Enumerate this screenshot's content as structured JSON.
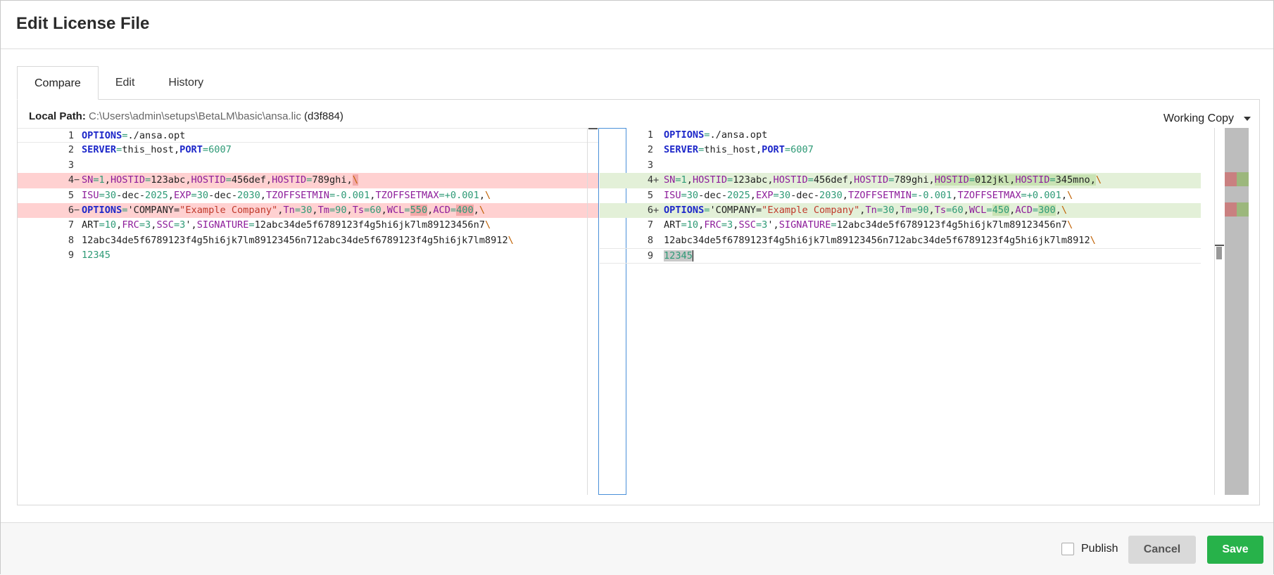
{
  "dialog": {
    "title": "Edit License File",
    "tabs": [
      {
        "label": "Compare",
        "active": true
      },
      {
        "label": "Edit",
        "active": false
      },
      {
        "label": "History",
        "active": false
      }
    ]
  },
  "compare": {
    "local_path_label": "Local Path:",
    "local_path": "C:\\Users\\admin\\setups\\BetaLM\\basic\\ansa.lic",
    "hash": "(d3f884)",
    "version_selector": "Working Copy",
    "line_numbers": [
      "1",
      "2",
      "3",
      "4",
      "5",
      "6",
      "7",
      "8",
      "9"
    ],
    "left_markers": [
      "",
      "",
      "",
      "−",
      "",
      "−",
      "",
      "",
      ""
    ],
    "right_markers": [
      "",
      "",
      "",
      "+",
      "",
      "+",
      "",
      "",
      ""
    ]
  },
  "footer": {
    "publish_label": "Publish",
    "cancel_label": "Cancel",
    "save_label": "Save"
  },
  "colors": {
    "deleted_line": "#ffd1d1",
    "added_line": "#e3f0d8",
    "save_button": "#27b24a",
    "keyword": "#1d27c9",
    "param": "#8d1c9a",
    "value": "#2e9a76"
  }
}
